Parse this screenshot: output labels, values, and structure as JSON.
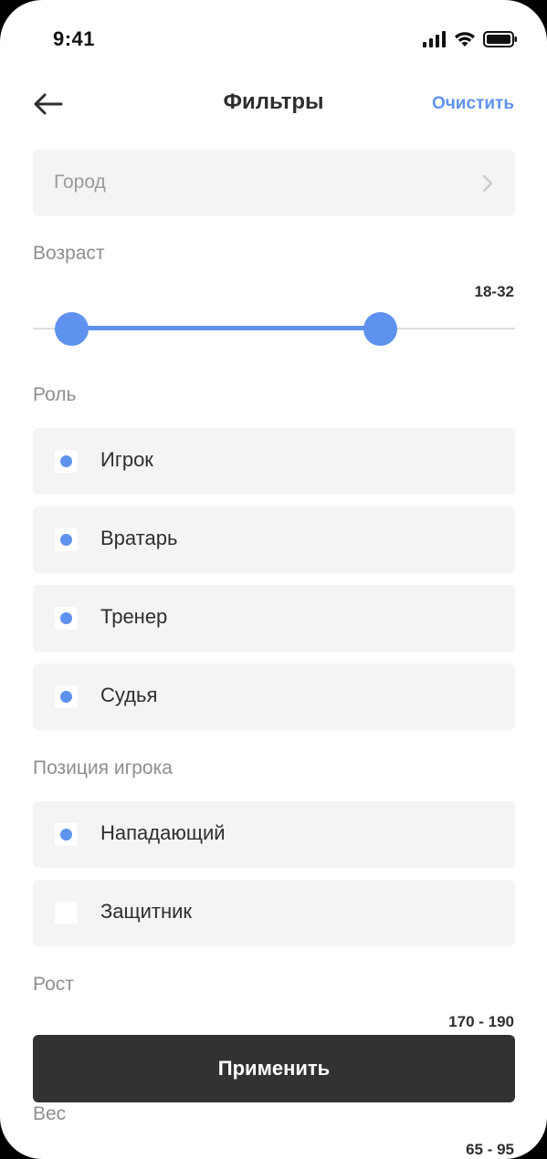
{
  "status_bar": {
    "time": "9:41"
  },
  "header": {
    "title": "Фильтры",
    "clear_label": "Очистить"
  },
  "city": {
    "placeholder": "Город"
  },
  "age": {
    "label": "Возраст",
    "value_text": "18-32",
    "range_fraction": [
      0.08,
      0.72
    ]
  },
  "role": {
    "label": "Роль",
    "options": [
      {
        "label": "Игрок",
        "checked": true
      },
      {
        "label": "Вратарь",
        "checked": true
      },
      {
        "label": "Тренер",
        "checked": true
      },
      {
        "label": "Судья",
        "checked": true
      }
    ]
  },
  "position": {
    "label": "Позиция игрока",
    "options": [
      {
        "label": "Нападающий",
        "checked": true
      },
      {
        "label": "Защитник",
        "checked": false
      }
    ]
  },
  "height": {
    "label": "Рост",
    "value_text": "170 - 190"
  },
  "weight": {
    "label": "Вес",
    "value_text": "65 - 95"
  },
  "apply_label": "Применить",
  "colors": {
    "accent": "#5f92ee",
    "field_bg": "#f4f4f6",
    "button_dark": "#333233"
  }
}
